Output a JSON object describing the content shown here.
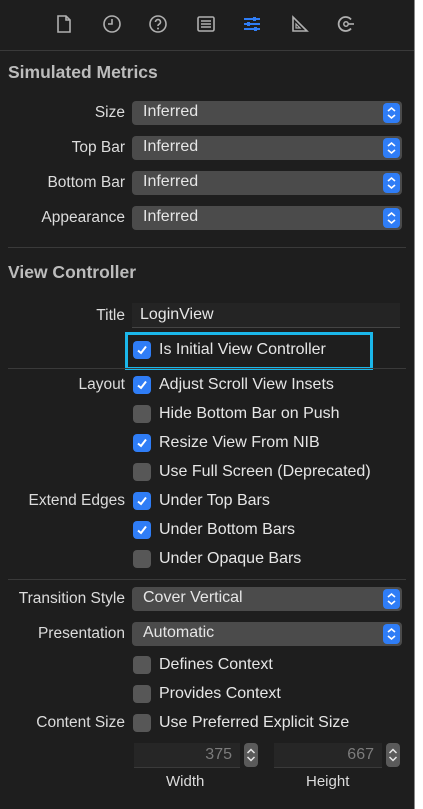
{
  "toolbar": {
    "icons": [
      "file-icon",
      "history-icon",
      "help-icon",
      "identity-icon",
      "attributes-icon",
      "size-icon",
      "connections-icon"
    ]
  },
  "simulated_metrics": {
    "title": "Simulated Metrics",
    "rows": [
      {
        "label": "Size",
        "value": "Inferred"
      },
      {
        "label": "Top Bar",
        "value": "Inferred"
      },
      {
        "label": "Bottom Bar",
        "value": "Inferred"
      },
      {
        "label": "Appearance",
        "value": "Inferred"
      }
    ]
  },
  "view_controller": {
    "title": "View Controller",
    "title_label": "Title",
    "title_value": "LoginView",
    "initial": {
      "label": "Is Initial View Controller",
      "checked": true
    },
    "layout_label": "Layout",
    "layout_options": [
      {
        "label": "Adjust Scroll View Insets",
        "checked": true
      },
      {
        "label": "Hide Bottom Bar on Push",
        "checked": false
      },
      {
        "label": "Resize View From NIB",
        "checked": true
      },
      {
        "label": "Use Full Screen (Deprecated)",
        "checked": false
      }
    ],
    "extend_edges_label": "Extend Edges",
    "extend_edges_options": [
      {
        "label": "Under Top Bars",
        "checked": true
      },
      {
        "label": "Under Bottom Bars",
        "checked": true
      },
      {
        "label": "Under Opaque Bars",
        "checked": false
      }
    ]
  },
  "presentation": {
    "transition_label": "Transition Style",
    "transition_value": "Cover Vertical",
    "presentation_label": "Presentation",
    "presentation_value": "Automatic",
    "context_options": [
      {
        "label": "Defines Context",
        "checked": false
      },
      {
        "label": "Provides Context",
        "checked": false
      }
    ],
    "content_size_label": "Content Size",
    "content_size_option": {
      "label": "Use Preferred Explicit Size",
      "checked": false
    },
    "width_value": "375",
    "height_value": "667",
    "width_label": "Width",
    "height_label": "Height"
  },
  "colors": {
    "panel_bg": "#1e1e1e",
    "accent": "#2f7df6",
    "highlight": "#1bb7ea"
  }
}
